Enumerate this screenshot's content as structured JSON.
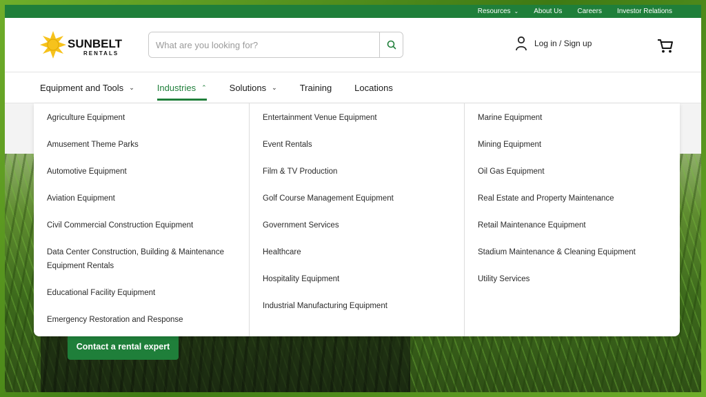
{
  "utility": {
    "resources": "Resources",
    "about": "About Us",
    "careers": "Careers",
    "investor": "Investor Relations"
  },
  "header": {
    "brand": "SUNBELT",
    "brand_sub": "RENTALS",
    "search_placeholder": "What are you looking for?",
    "login": "Log in / Sign up"
  },
  "nav": {
    "items": [
      {
        "label": "Equipment and Tools"
      },
      {
        "label": "Industries"
      },
      {
        "label": "Solutions"
      },
      {
        "label": "Training"
      },
      {
        "label": "Locations"
      }
    ]
  },
  "dropdown": {
    "col1": [
      "Agriculture Equipment",
      "Amusement Theme Parks",
      "Automotive Equipment",
      "Aviation Equipment",
      "Civil Commercial Construction Equipment",
      "Data Center Construction, Building & Maintenance Equipment Rentals",
      "Educational Facility Equipment",
      "Emergency Restoration and Response"
    ],
    "col2": [
      "Entertainment Venue Equipment",
      "Event Rentals",
      "Film & TV Production",
      "Golf Course Management Equipment",
      "Government Services",
      "Healthcare",
      "Hospitality Equipment",
      "Industrial Manufacturing Equipment"
    ],
    "col3": [
      "Marine Equipment",
      "Mining Equipment",
      "Oil Gas Equipment",
      "Real Estate and Property Maintenance",
      "Retail Maintenance Equipment",
      "Stadium Maintenance & Cleaning Equipment",
      "Utility Services"
    ]
  },
  "hero": {
    "cta": "Contact a rental expert"
  },
  "colors": {
    "brand_green": "#1f7f3a",
    "logo_yellow": "#f6c21c"
  }
}
